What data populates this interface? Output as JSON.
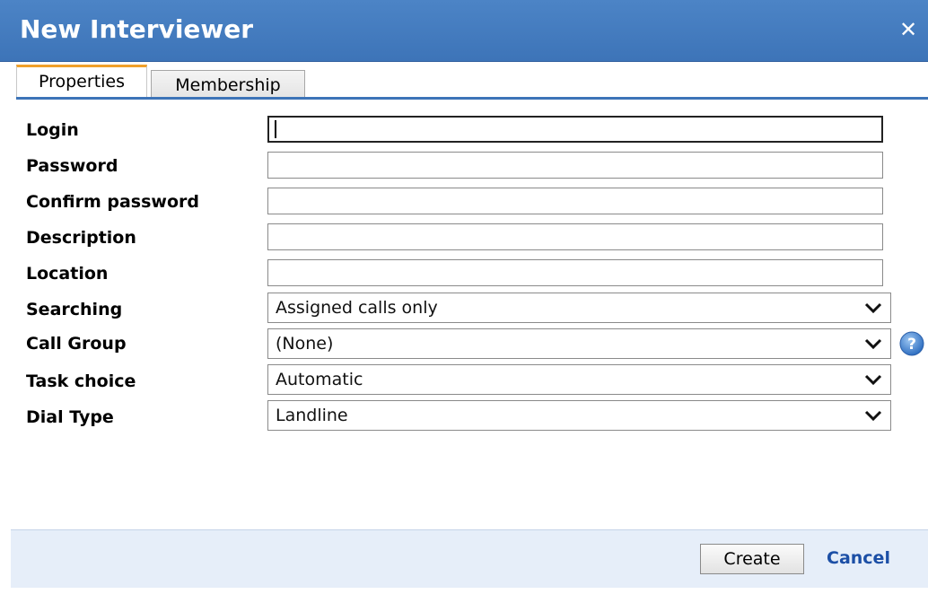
{
  "dialog": {
    "title": "New Interviewer",
    "close_icon": "close-icon"
  },
  "tabs": [
    {
      "label": "Properties",
      "active": true
    },
    {
      "label": "Membership",
      "active": false
    }
  ],
  "form": {
    "login_label": "Login",
    "login_value": "",
    "password_label": "Password",
    "password_value": "",
    "confirm_password_label": "Confirm password",
    "confirm_password_value": "",
    "description_label": "Description",
    "description_value": "",
    "location_label": "Location",
    "location_value": "",
    "searching_label": "Searching",
    "searching_value": "Assigned calls only",
    "call_group_label": "Call Group",
    "call_group_value": "(None)",
    "task_choice_label": "Task choice",
    "task_choice_value": "Automatic",
    "dial_type_label": "Dial Type",
    "dial_type_value": "Landline",
    "help_icon": "help-icon"
  },
  "footer": {
    "create_label": "Create",
    "cancel_label": "Cancel"
  },
  "colors": {
    "titlebar": "#3d74b8",
    "tab_accent": "#f0a02a",
    "footer_bg": "#e6eef9",
    "link": "#1c4fa6"
  }
}
